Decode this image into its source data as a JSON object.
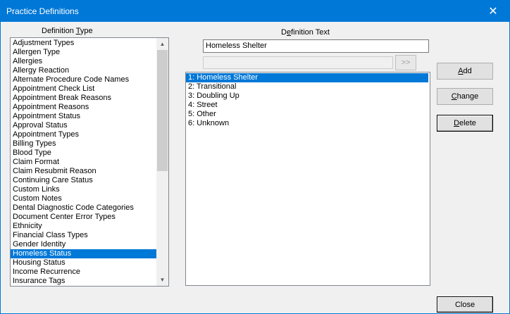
{
  "window": {
    "title": "Practice Definitions"
  },
  "definition_type": {
    "label_prefix": "Definition ",
    "label_accel": "T",
    "label_suffix": "ype",
    "items": [
      "Adjustment Types",
      "Allergen Type",
      "Allergies",
      "Allergy Reaction",
      "Alternate Procedure Code Names",
      "Appointment Check List",
      "Appointment Break Reasons",
      "Appointment Reasons",
      "Appointment Status",
      "Approval Status",
      "Appointment Types",
      "Billing Types",
      "Blood Type",
      "Claim Format",
      "Claim Resubmit Reason",
      "Continuing Care Status",
      "Custom Links",
      "Custom Notes",
      "Dental Diagnostic Code Categories",
      "Document Center Error Types",
      "Ethnicity",
      "Financial Class Types",
      "Gender Identity",
      "Homeless Status",
      "Housing Status",
      "Income Recurrence",
      "Insurance Tags"
    ],
    "selected_index": 23
  },
  "definition_text": {
    "label_prefix": "D",
    "label_accel": "e",
    "label_suffix": "finition Text",
    "value": "Homeless Shelter",
    "secondary_value": "",
    "move_button": ">>",
    "items": [
      "1: Homeless Shelter",
      "2: Transitional",
      "3: Doubling Up",
      "4: Street",
      "5: Other",
      "6: Unknown"
    ],
    "selected_index": 0
  },
  "buttons": {
    "add": {
      "accel": "A",
      "rest": "dd"
    },
    "change": {
      "accel": "C",
      "rest": "hange"
    },
    "delete": {
      "accel": "D",
      "rest": "elete"
    },
    "close": "Close"
  },
  "icons": {
    "close": "close-icon",
    "scroll_up": "chevron-up-icon",
    "scroll_down": "chevron-down-icon"
  },
  "colors": {
    "titlebar": "#0078d7",
    "selection": "#0078d7"
  }
}
